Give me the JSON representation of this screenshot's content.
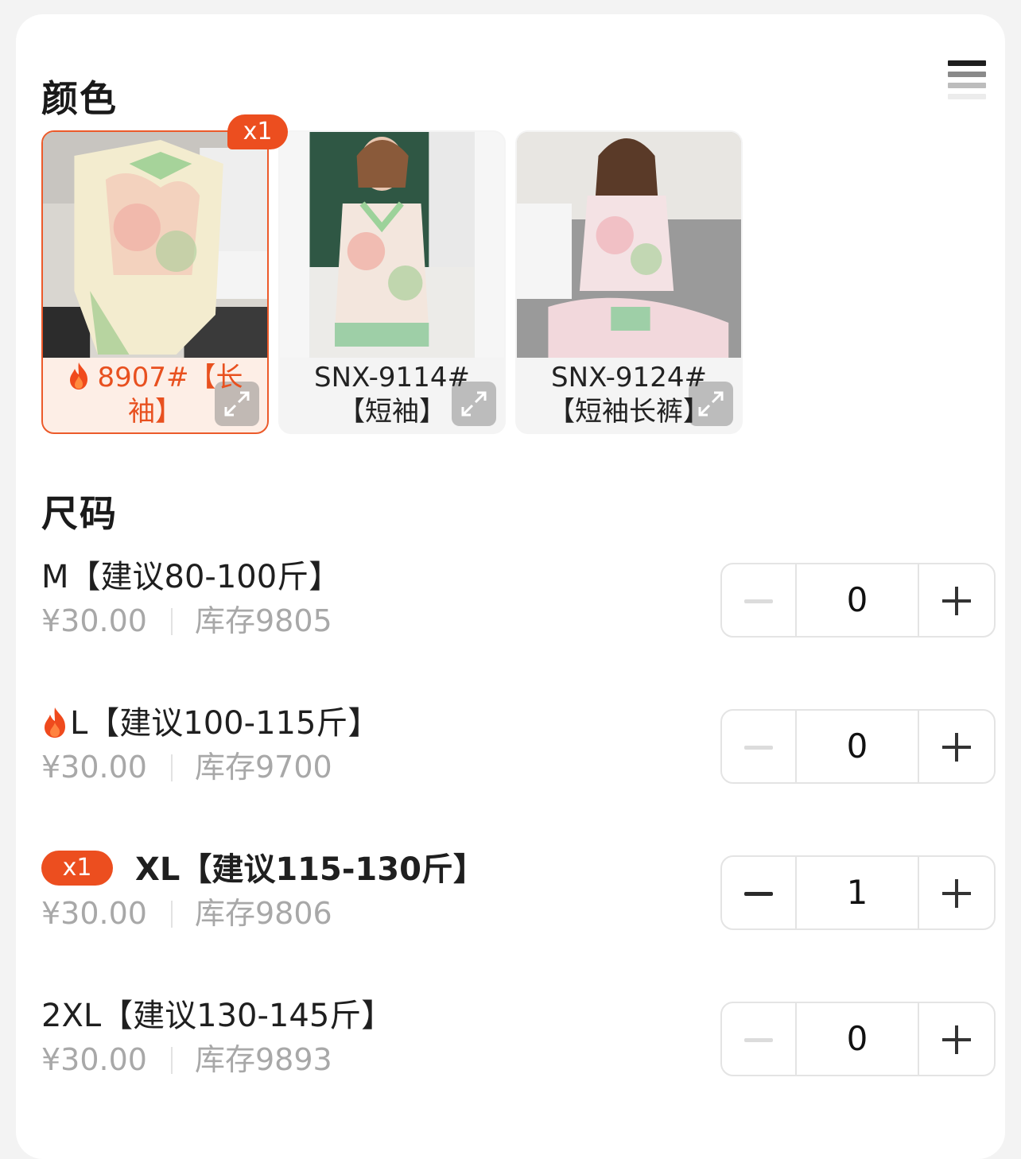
{
  "sections": {
    "color_title": "颜色",
    "size_title": "尺码"
  },
  "colors": [
    {
      "label": "8907#【长袖】",
      "line1": "8907#【长",
      "line2": "袖】",
      "selected": true,
      "badge": "x1",
      "hot": true
    },
    {
      "label": "SNX-9114#【短袖】",
      "line1": "SNX-9114#",
      "line2": "【短袖】",
      "selected": false
    },
    {
      "label": "SNX-9124#【短袖长裤】",
      "line1": "SNX-9124#",
      "line2": "【短袖长裤】",
      "selected": false
    }
  ],
  "sizes": [
    {
      "name": "M【建议80-100斤】",
      "price": "¥30.00",
      "stock": "库存9805",
      "qty": "0"
    },
    {
      "name": "L【建议100-115斤】",
      "price": "¥30.00",
      "stock": "库存9700",
      "qty": "0",
      "hot": true
    },
    {
      "name": "XL【建议115-130斤】",
      "price": "¥30.00",
      "stock": "库存9806",
      "qty": "1",
      "badge": "x1",
      "selected": true
    },
    {
      "name": "2XL【建议130-145斤】",
      "price": "¥30.00",
      "stock": "库存9893",
      "qty": "0"
    }
  ],
  "colors_theme": {
    "accent": "#ec4e1f",
    "selected_bg": "#fdeee6",
    "muted_text": "#a8a8a8"
  }
}
